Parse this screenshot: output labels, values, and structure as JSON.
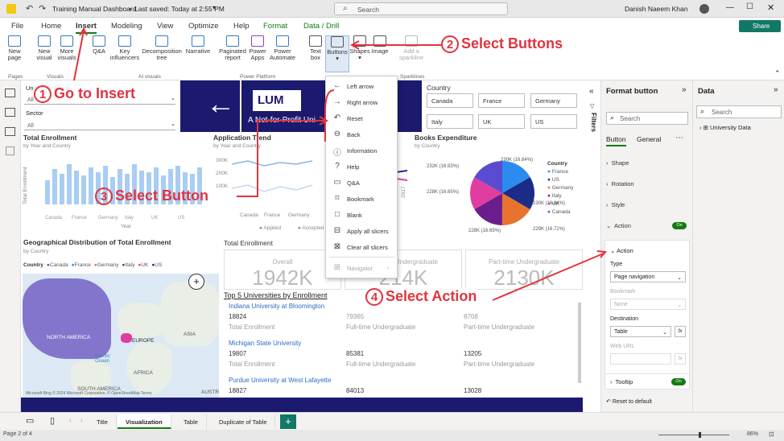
{
  "title_bar": {
    "doc_title": "Training Manual Dashboard",
    "saved": "Last saved: Today at 2:55 PM",
    "search_placeholder": "Search",
    "user": "Danish Naeem Khan"
  },
  "ribbon_tabs": [
    "File",
    "Home",
    "Insert",
    "Modeling",
    "View",
    "Optimize",
    "Help",
    "Format",
    "Data / Drill"
  ],
  "share_label": "Share",
  "ribbon": {
    "pages": {
      "btn": "New page",
      "group": "Pages"
    },
    "visuals": {
      "btns": [
        "New visual",
        "More visuals"
      ],
      "group": "Visuals"
    },
    "ai": {
      "btns": [
        "Q&A",
        "Key influencers",
        "Decomposition tree",
        "Narrative"
      ],
      "group": "AI visuals"
    },
    "power": {
      "btns": [
        "Paginated report",
        "Power Apps",
        "Power Automate"
      ],
      "group": "Power Platform"
    },
    "elements": {
      "btns": [
        "Text box",
        "Buttons",
        "Shapes",
        "Image"
      ]
    },
    "sparklines": {
      "btn": "Add a sparkline",
      "group": "Sparklines"
    }
  },
  "buttons_menu": [
    "Left arrow",
    "Right arrow",
    "Reset",
    "Back",
    "Information",
    "Help",
    "Q&A",
    "Bookmark",
    "Blank",
    "Apply all slicers",
    "Clear all slicers",
    "Navigator"
  ],
  "callouts": {
    "c1": "Go to Insert",
    "c2": "Select Buttons",
    "c3": "Select Button",
    "c4": "Select Action",
    "n1": "1",
    "n2": "2",
    "n3": "3",
    "n4": "4"
  },
  "slicers": {
    "university_label": "University Name",
    "all1": "All",
    "sector_label": "Sector",
    "all2": "All"
  },
  "country_slicer": {
    "title": "Country",
    "items": [
      "Canada",
      "France",
      "Germany",
      "Italy",
      "UK",
      "US"
    ]
  },
  "banner_text": "A Not-for-Profit Uni",
  "banner_logo": "LUM",
  "total_enrollment": {
    "title": "Total Enrollment",
    "sub": "by Year and Country",
    "ylabel": "Total Enrollment",
    "xlabel": "Year",
    "x": [
      "Canada",
      "France",
      "Germany",
      "Italy",
      "UK",
      "US"
    ]
  },
  "app_trend": {
    "title": "Application Trend",
    "sub": "by Year and Country",
    "x": [
      "Canada",
      "France",
      "Germany"
    ],
    "y": [
      "300K",
      "200K",
      "100K"
    ],
    "legend": [
      "Applied",
      "Accepted"
    ],
    "right_tick": "2017"
  },
  "books": {
    "title": "Books Expenditure",
    "sub": "by Country",
    "legend_title": "Country",
    "labels": [
      "230K (16.84%)",
      "230K (16.84%)",
      "229K (16.72%)",
      "228K (16.65%)",
      "228K (16.65%)",
      "232K (16.93%)"
    ]
  },
  "chart_data": {
    "type": "pie",
    "title": "Books Expenditure",
    "categories": [
      "France",
      "US",
      "Germany",
      "Italy",
      "UK",
      "Canada"
    ],
    "values": [
      230,
      230,
      229,
      228,
      228,
      232
    ],
    "colors": [
      "#2b8bef",
      "#1b2b88",
      "#e8732e",
      "#6c1d8c",
      "#e03da1",
      "#5a4bd1"
    ]
  },
  "geo": {
    "title": "Geographical Distribution of Total Enrollment",
    "sub": "by Country",
    "legend_label": "Country",
    "legend": [
      "Canada",
      "France",
      "Germany",
      "Italy",
      "UK",
      "US"
    ],
    "legend_colors": [
      "#5a4bd1",
      "#2b8bef",
      "#e8732e",
      "#6c1d8c",
      "#e03da1",
      "#1b2b88"
    ],
    "regions": [
      "NORTH AMERICA",
      "EUROPE",
      "ASIA",
      "AFRICA",
      "SOUTH AMERICA",
      "Atlantic Ocean",
      "AUSTR"
    ],
    "credit": "Microsoft Bing  © 2024 Microsoft Corporation, © OpenStreetMap Terms"
  },
  "kpi": {
    "title": "Total Enrollment",
    "cards": [
      {
        "label": "Overall",
        "value": "1942K"
      },
      {
        "label": "Full-time Undergraduate",
        "value": "214K"
      },
      {
        "label": "Part-time Undergraduate",
        "value": "2130K"
      }
    ]
  },
  "top5": {
    "title": "Top 5 Universities by Enrollment",
    "rows": [
      {
        "name": "Indiana University at Bloomington",
        "a": "18824",
        "b": "79365",
        "c": "8708"
      },
      {
        "name": "Michigan State University",
        "a": "19807",
        "b": "85381",
        "c": "13205"
      },
      {
        "name": "Purdue University at West Lafayette",
        "a": "18827",
        "b": "84013",
        "c": "13028"
      }
    ],
    "labels": [
      "Total Enrollment",
      "Full-time Undergraduate",
      "Part-time Undergraduate"
    ]
  },
  "format_pane": {
    "title": "Format button",
    "search": "Search",
    "tabs": [
      "Button",
      "General"
    ],
    "sections": [
      "Shape",
      "Rotation",
      "Style",
      "Action"
    ],
    "toggle": "On",
    "action_title": "Action",
    "type_label": "Type",
    "type_value": "Page navigation",
    "bookmark_label": "Bookmark",
    "bookmark_value": "None",
    "dest_label": "Destination",
    "dest_value": "Table",
    "weburl_label": "Web URL",
    "fx": "fx",
    "tooltip": "Tooltip",
    "reset": "Reset to default"
  },
  "filters_label": "Filters",
  "data_pane": {
    "title": "Data",
    "search": "Search",
    "table": "University Data"
  },
  "page_tabs": [
    "Title",
    "Visualization",
    "Table",
    "Duplicate of Table"
  ],
  "status": {
    "page": "Page 2 of 4",
    "zoom": "86%"
  }
}
